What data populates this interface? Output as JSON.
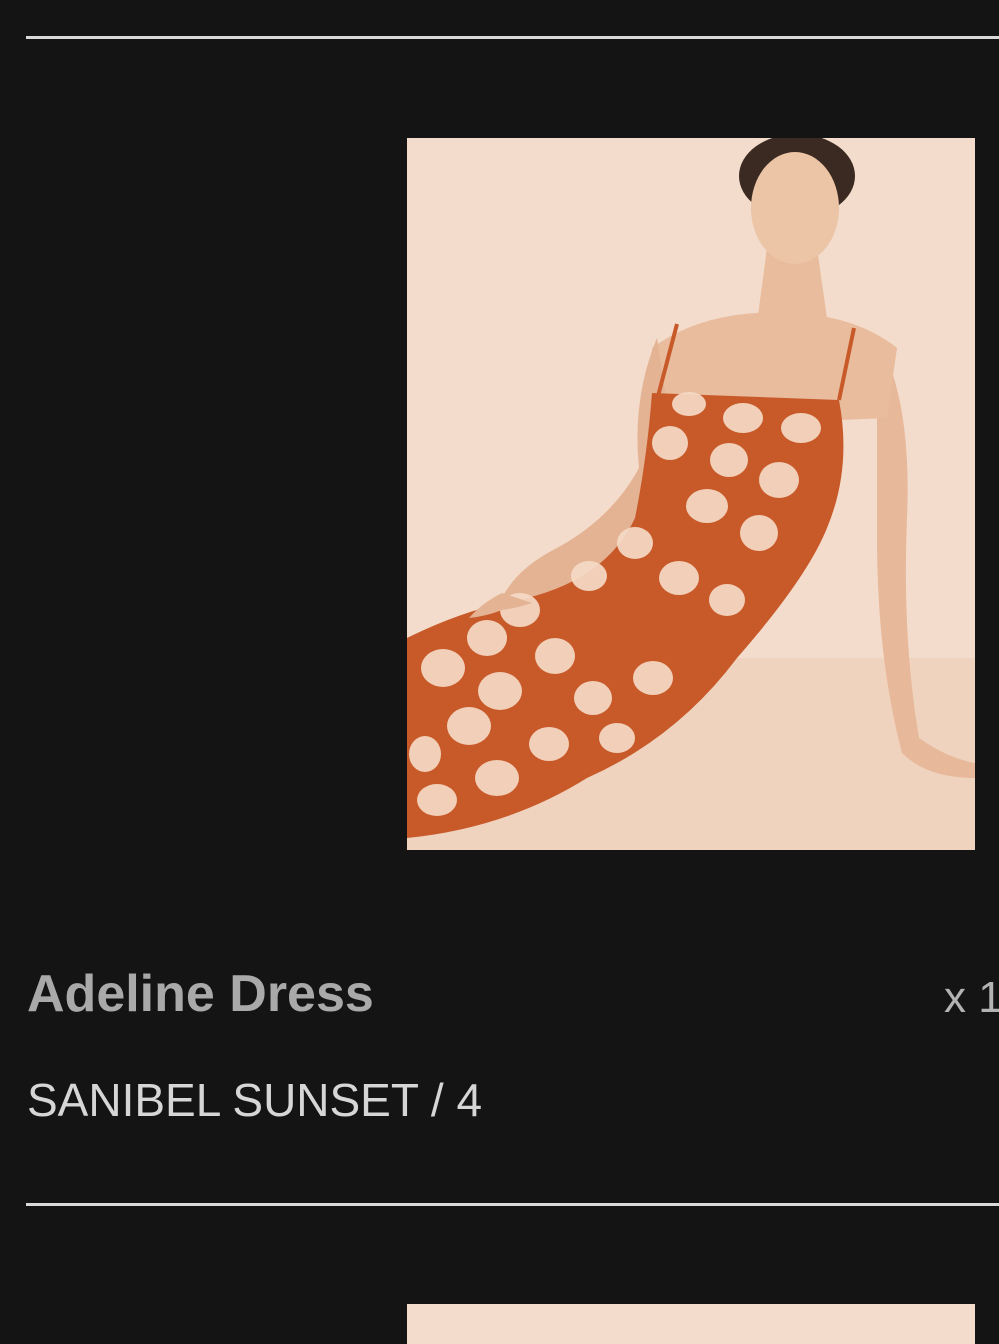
{
  "cart_item": {
    "name": "Adeline Dress",
    "variant": "SANIBEL SUNSET / 4",
    "quantity_label": "x 1"
  },
  "image": {
    "icon": "product-photo",
    "dress_color": "#c85a2a",
    "background_color": "#f3dccb"
  }
}
